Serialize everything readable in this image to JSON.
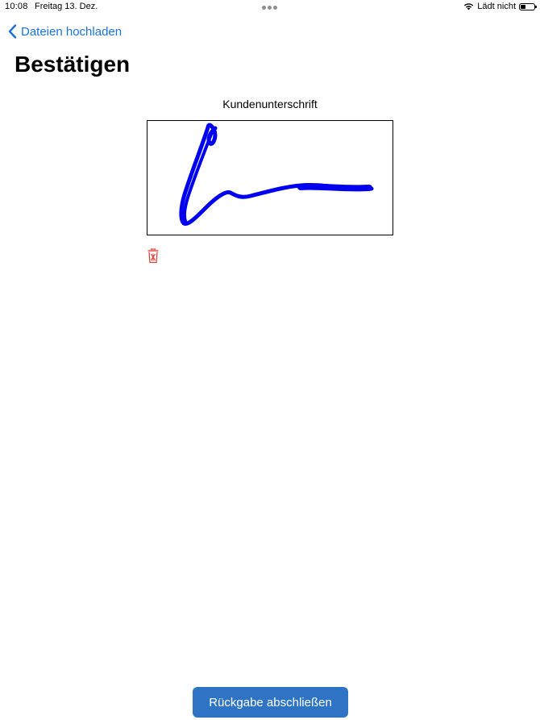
{
  "status_bar": {
    "time": "10:08",
    "date": "Freitag 13. Dez.",
    "charging_text": "Lädt nicht",
    "wifi_icon": "wifi-icon",
    "battery_icon": "battery-icon"
  },
  "nav": {
    "back_label": "Dateien hochladen",
    "back_icon": "chevron-left-icon"
  },
  "page": {
    "title": "Bestätigen"
  },
  "signature": {
    "label": "Kundenunterschrift",
    "stroke_color": "#0000ee",
    "clear_icon": "trash-icon",
    "clear_icon_color": "#e0453a"
  },
  "footer": {
    "submit_label": "Rückgabe abschließen",
    "accent_color": "#2e73c4"
  }
}
